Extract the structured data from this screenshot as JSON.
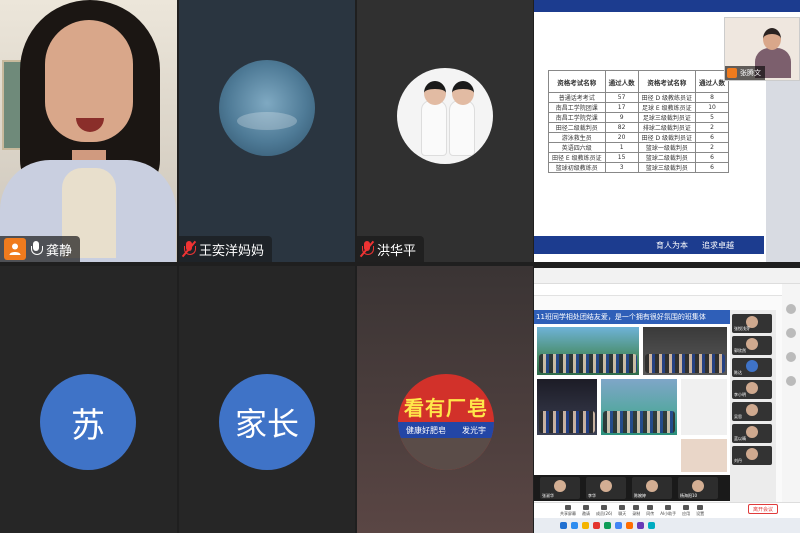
{
  "participants": [
    {
      "name": "龚静",
      "mic": "on",
      "host": true
    },
    {
      "name": "王奕洋妈妈",
      "mic": "muted"
    },
    {
      "name": "洪华平",
      "mic": "muted"
    },
    {
      "name": "",
      "avatar_text": "苏"
    },
    {
      "name": "",
      "avatar_text": "家长"
    },
    {
      "name": "",
      "shop_text": "看有厂皂",
      "shop_sub_1": "健康好肥皂",
      "shop_sub_2": "发光宇"
    }
  ],
  "shared_screen_1": {
    "table_headers": [
      "资格考试名称",
      "通过人数",
      "资格考试名称",
      "通过人数"
    ],
    "rows": [
      [
        "普通话考考试",
        "57",
        "田径 D 级教练员证",
        "8"
      ],
      [
        "南昌工学院团课",
        "17",
        "足球 E 级教练员证",
        "10"
      ],
      [
        "南昌工学院党课",
        "9",
        "足球三级裁判员证",
        "5"
      ],
      [
        "田径二级裁判员",
        "82",
        "排球二级裁判员证",
        "2"
      ],
      [
        "游泳救生员",
        "20",
        "田径 D 级裁判员证",
        "6"
      ],
      [
        "英语四六级",
        "1",
        "篮球一级裁判员",
        "2"
      ],
      [
        "田径 E 级教练员证",
        "15",
        "篮球二级裁判员",
        "6"
      ],
      [
        "篮球初级教练员",
        "3",
        "篮球三级裁判员",
        "6"
      ]
    ],
    "footer_text_1": "育人为本",
    "footer_text_2": "追求卓越",
    "presenter_name": "张腾文"
  },
  "shared_screen_2": {
    "caption": "11班同学相处团结友爱，是一个拥有很好氛围的班集体",
    "end_button": "离开会议",
    "side_labels": [
      "张悦浅芽",
      "郭欣然",
      "陈达",
      "李小明",
      "吴思",
      "蓝以晴",
      "刘丹"
    ],
    "strip_labels": [
      "张淑华",
      "李华",
      "陈婉婷",
      "杨海阳10"
    ],
    "toolbar_items": [
      "共享屏幕",
      "邀请",
      "成员(26)",
      "聊天",
      "录制",
      "同传",
      "AI小助手",
      "应用",
      "设置"
    ]
  }
}
